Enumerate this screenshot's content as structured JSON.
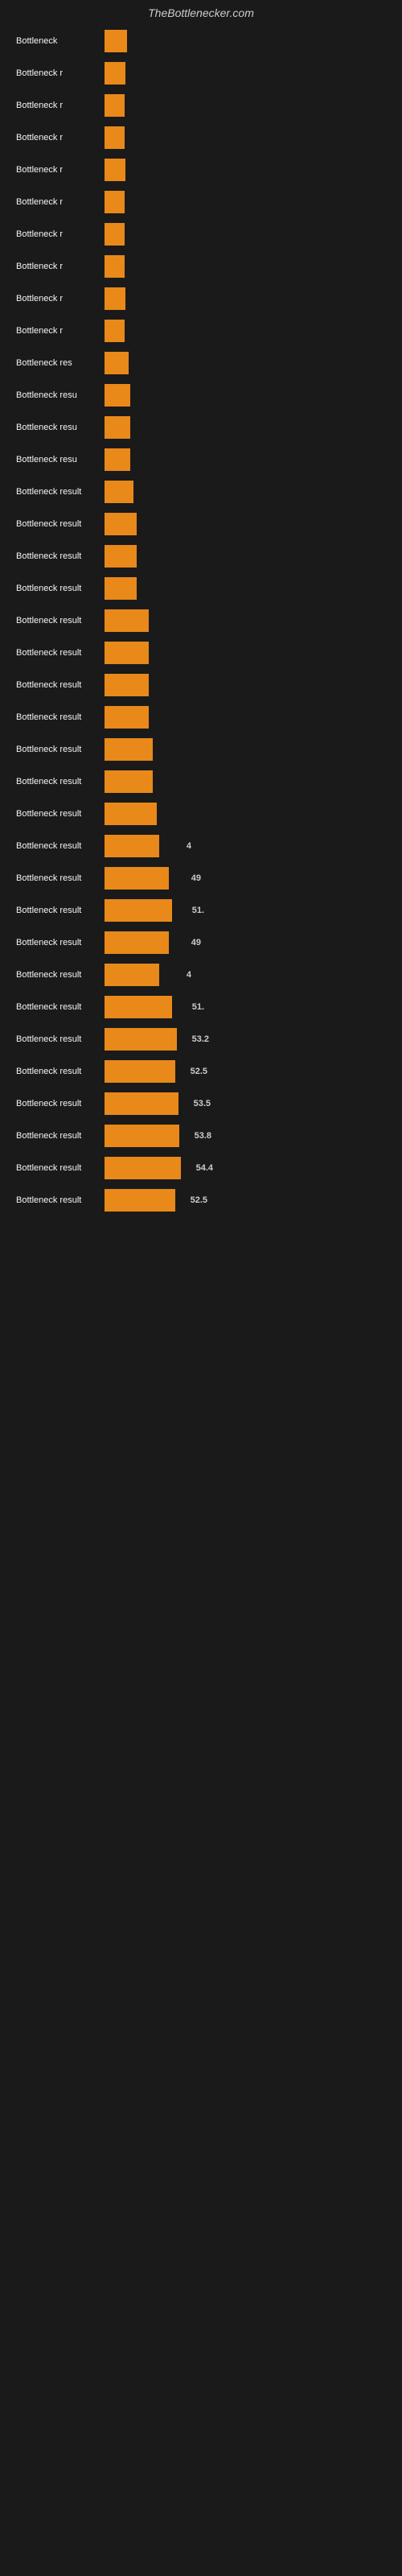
{
  "site_title": "TheBottlenecker.com",
  "bars": [
    {
      "label": "Bottleneck",
      "value": null,
      "width": 28
    },
    {
      "label": "Bottleneck r",
      "value": null,
      "width": 26
    },
    {
      "label": "Bottleneck r",
      "value": null,
      "width": 25
    },
    {
      "label": "Bottleneck r",
      "value": null,
      "width": 25
    },
    {
      "label": "Bottleneck r",
      "value": null,
      "width": 26
    },
    {
      "label": "Bottleneck r",
      "value": null,
      "width": 25
    },
    {
      "label": "Bottleneck r",
      "value": null,
      "width": 25
    },
    {
      "label": "Bottleneck r",
      "value": null,
      "width": 25
    },
    {
      "label": "Bottleneck r",
      "value": null,
      "width": 26
    },
    {
      "label": "Bottleneck r",
      "value": null,
      "width": 25
    },
    {
      "label": "Bottleneck res",
      "value": null,
      "width": 30
    },
    {
      "label": "Bottleneck resu",
      "value": null,
      "width": 32
    },
    {
      "label": "Bottleneck resu",
      "value": null,
      "width": 32
    },
    {
      "label": "Bottleneck resu",
      "value": null,
      "width": 32
    },
    {
      "label": "Bottleneck result",
      "value": null,
      "width": 36
    },
    {
      "label": "Bottleneck result",
      "value": null,
      "width": 40
    },
    {
      "label": "Bottleneck result",
      "value": null,
      "width": 40
    },
    {
      "label": "Bottleneck result",
      "value": null,
      "width": 40
    },
    {
      "label": "Bottleneck result",
      "value": null,
      "width": 55
    },
    {
      "label": "Bottleneck result",
      "value": null,
      "width": 55
    },
    {
      "label": "Bottleneck result",
      "value": null,
      "width": 55
    },
    {
      "label": "Bottleneck result",
      "value": null,
      "width": 55
    },
    {
      "label": "Bottleneck result",
      "value": null,
      "width": 60
    },
    {
      "label": "Bottleneck result",
      "value": null,
      "width": 60
    },
    {
      "label": "Bottleneck result",
      "value": null,
      "width": 65
    },
    {
      "label": "Bottleneck result",
      "value": "4",
      "width": 68
    },
    {
      "label": "Bottleneck result",
      "value": "49",
      "width": 80
    },
    {
      "label": "Bottleneck result",
      "value": "51.",
      "width": 84
    },
    {
      "label": "Bottleneck result",
      "value": "49",
      "width": 80
    },
    {
      "label": "Bottleneck result",
      "value": "4",
      "width": 68
    },
    {
      "label": "Bottleneck result",
      "value": "51.",
      "width": 84
    },
    {
      "label": "Bottleneck result",
      "value": "53.2",
      "width": 90
    },
    {
      "label": "Bottleneck result",
      "value": "52.5",
      "width": 88
    },
    {
      "label": "Bottleneck result",
      "value": "53.5",
      "width": 92
    },
    {
      "label": "Bottleneck result",
      "value": "53.8",
      "width": 93
    },
    {
      "label": "Bottleneck result",
      "value": "54.4",
      "width": 95
    },
    {
      "label": "Bottleneck result",
      "value": "52.5",
      "width": 88
    }
  ],
  "colors": {
    "background": "#1a1a1a",
    "bar": "#e8891a",
    "text": "#cccccc",
    "title": "#cccccc"
  }
}
